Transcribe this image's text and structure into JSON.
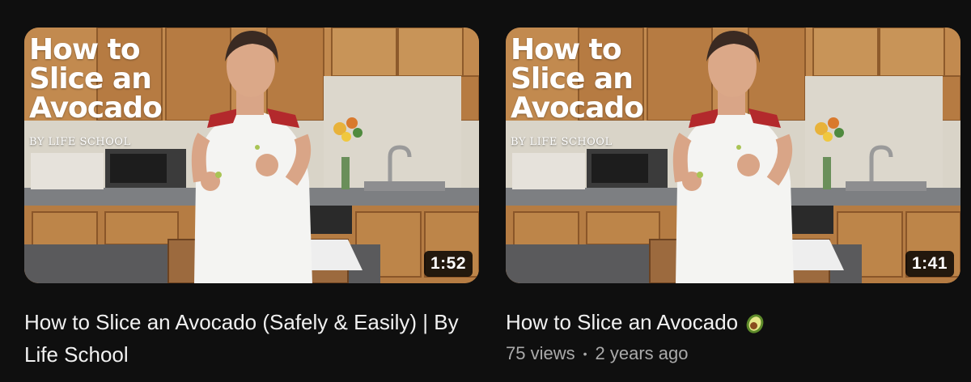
{
  "videos": [
    {
      "thumbnail": {
        "title_lines": [
          "How to",
          "Slice an",
          "Avocado"
        ],
        "byline": "BY LIFE SCHOOL",
        "duration": "1:52"
      },
      "title": "How to Slice an Avocado (Safely & Easily) | By Life School"
    },
    {
      "thumbnail": {
        "title_lines": [
          "How to",
          "Slice an",
          "Avocado"
        ],
        "byline": "BY LIFE SCHOOL",
        "duration": "1:41"
      },
      "title": "How to Slice an Avocado",
      "title_icon": "avocado-icon",
      "views": "75 views",
      "separator": "•",
      "age": "2 years ago"
    }
  ],
  "colors": {
    "background": "#0f0f0f",
    "title_text": "#f1f1f1",
    "meta_text": "#aaaaaa"
  }
}
